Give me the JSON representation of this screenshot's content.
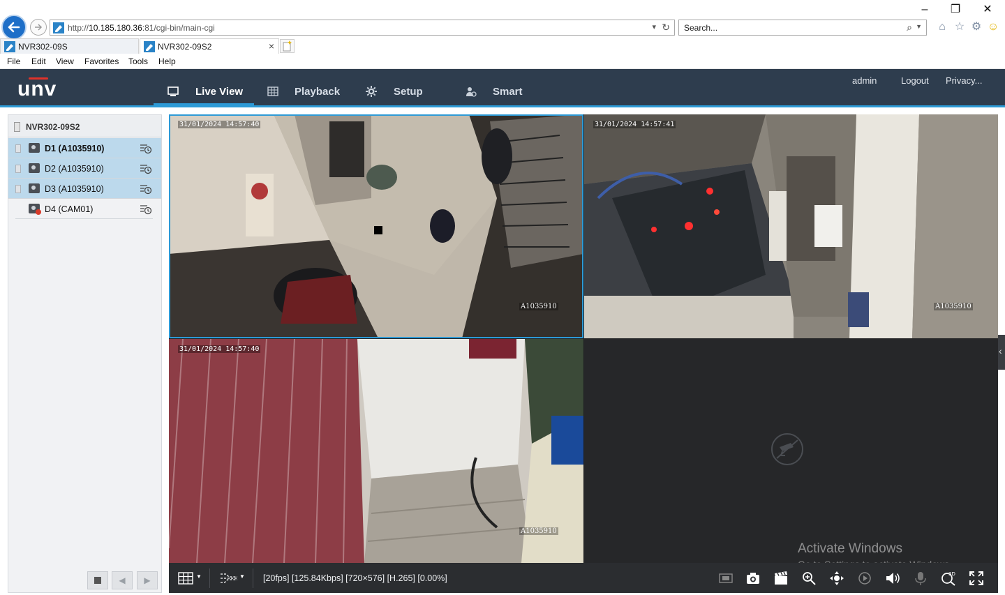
{
  "browser": {
    "url_prefix": "http://",
    "url_host": "10.185.180.36",
    "url_rest": ":81/cgi-bin/main-cgi",
    "search_placeholder": "Search...",
    "tabs": [
      {
        "label": "NVR302-09S"
      },
      {
        "label": "NVR302-09S2"
      }
    ],
    "menu": [
      "File",
      "Edit",
      "View",
      "Favorites",
      "Tools",
      "Help"
    ]
  },
  "nvr": {
    "logo": "unv",
    "nav": {
      "live_view": "Live View",
      "playback": "Playback",
      "setup": "Setup",
      "smart": "Smart"
    },
    "user": "admin",
    "logout": "Logout",
    "privacy": "Privacy..."
  },
  "devices": {
    "title": "NVR302-09S2",
    "cameras": [
      {
        "label": "D1 (A1035910)",
        "selected": true,
        "online": true
      },
      {
        "label": "D2 (A1035910)",
        "selected": true,
        "online": true
      },
      {
        "label": "D3 (A1035910)",
        "selected": true,
        "online": true
      },
      {
        "label": "D4 (CAM01)",
        "selected": false,
        "online": false
      }
    ]
  },
  "tiles": [
    {
      "time": "31/01/2024 14:57:40",
      "id": "A1035910"
    },
    {
      "time": "31/01/2024 14:57:41",
      "id": "A1035910"
    },
    {
      "time": "31/01/2024 14:57:40",
      "id": "A1035910"
    }
  ],
  "stream_info": "[20fps] [125.84Kbps] [720×576] [H.265] [0.00%]",
  "watermark": {
    "line1": "Activate Windows",
    "line2": "Go to Settings to activate Windows."
  }
}
